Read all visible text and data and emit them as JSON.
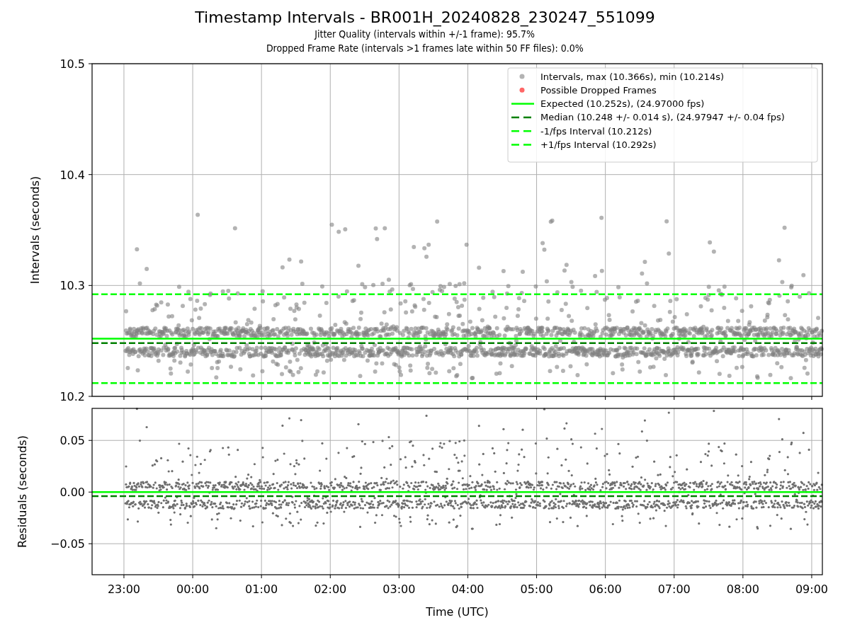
{
  "figure": {
    "title": "Timestamp Intervals - BR001H_20240828_230247_551099",
    "subtitles": [
      "Jitter Quality (intervals within +/-1 frame): 95.7%",
      "Dropped Frame Rate (intervals >1 frames late within 50 FF files): 0.0%"
    ]
  },
  "top_plot": {
    "chart_data": {
      "type": "scatter",
      "ylabel": "Intervals (seconds)",
      "grid": true,
      "categories": [
        null,
        null,
        null,
        null,
        null,
        null,
        null,
        null,
        null,
        null,
        null
      ],
      "ylim": [
        10.2,
        10.5
      ],
      "yticks": [
        {
          "value": 10.2,
          "label": "10.2"
        },
        {
          "value": 10.3,
          "label": "10.3"
        },
        {
          "value": 10.4,
          "label": "10.4"
        },
        {
          "value": 10.5,
          "label": "10.5"
        }
      ],
      "ref_lines": [
        {
          "axis": "y",
          "value": 10.252,
          "color": "#00ff00"
        },
        {
          "axis": "y",
          "value": 10.248,
          "color": "#008000"
        },
        {
          "axis": "y",
          "value": 10.212,
          "color": "#00ff00"
        },
        {
          "axis": "y",
          "value": 10.292,
          "color": "#00ff00"
        }
      ]
    },
    "legend": [
      {
        "label": "Intervals, max (10.366s), min (10.214s)",
        "kind": "marker",
        "color": "#b3b3b3"
      },
      {
        "label": "Possible Dropped Frames",
        "kind": "marker",
        "color": "#ff6666"
      },
      {
        "label": "Expected (10.252s), (24.97000 fps)",
        "kind": "solid",
        "color": "#00ff00"
      },
      {
        "label": "Median (10.248 +/- 0.014 s), (24.97947 +/- 0.04 fps)",
        "kind": "dashed",
        "color": "#008000"
      },
      {
        "label": "-1/fps Interval (10.212s)",
        "kind": "dashed",
        "color": "#00ff00"
      },
      {
        "label": "+1/fps Interval (10.292s)",
        "kind": "dashed",
        "color": "#00ff00"
      }
    ]
  },
  "bottom_plot": {
    "chart_data": {
      "type": "scatter",
      "xlabel": "Time (UTC)",
      "ylabel": "Residuals (seconds)",
      "grid": true,
      "categories": [
        "23:00",
        "00:00",
        "01:00",
        "02:00",
        "03:00",
        "04:00",
        "05:00",
        "06:00",
        "07:00",
        "08:00",
        "09:00"
      ],
      "ylim": [
        -0.08,
        0.081
      ],
      "yticks": [
        {
          "value": 0.05,
          "label": "0.05"
        },
        {
          "value": 0,
          "label": "0.00"
        },
        {
          "value": -0.05,
          "label": "−0.05"
        }
      ],
      "ref_lines": [
        {
          "axis": "y",
          "value": 0,
          "color": "#00ff00"
        },
        {
          "axis": "y",
          "value": -0.004,
          "color": "#008000"
        }
      ]
    }
  }
}
